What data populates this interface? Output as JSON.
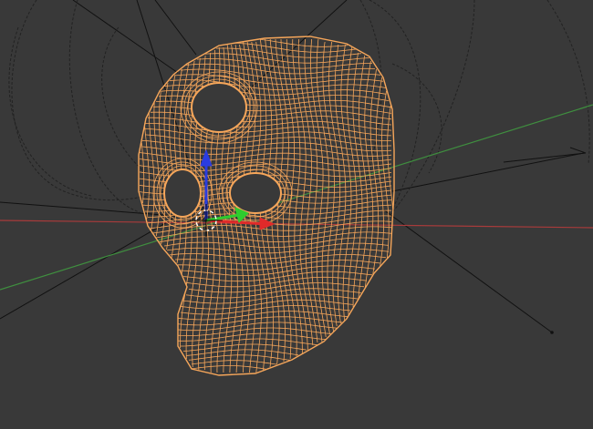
{
  "viewport": {
    "background": "#393939",
    "colors": {
      "wire": "#f6a65a",
      "x_axis": "#a83b3b",
      "y_axis": "#3f8f3f",
      "grid": "#1a1a1a",
      "curves": "#1e1e1e",
      "gizmo_x": "#e02a2a",
      "gizmo_y": "#2ecc2e",
      "gizmo_z": "#2a3ce0",
      "cursor_ring": "#ffffff"
    },
    "icons": {
      "selected_mesh": "skull-wireframe-mesh",
      "transform_gizmo": "translate-gizmo-icon",
      "cursor_3d": "3d-cursor-icon"
    }
  }
}
